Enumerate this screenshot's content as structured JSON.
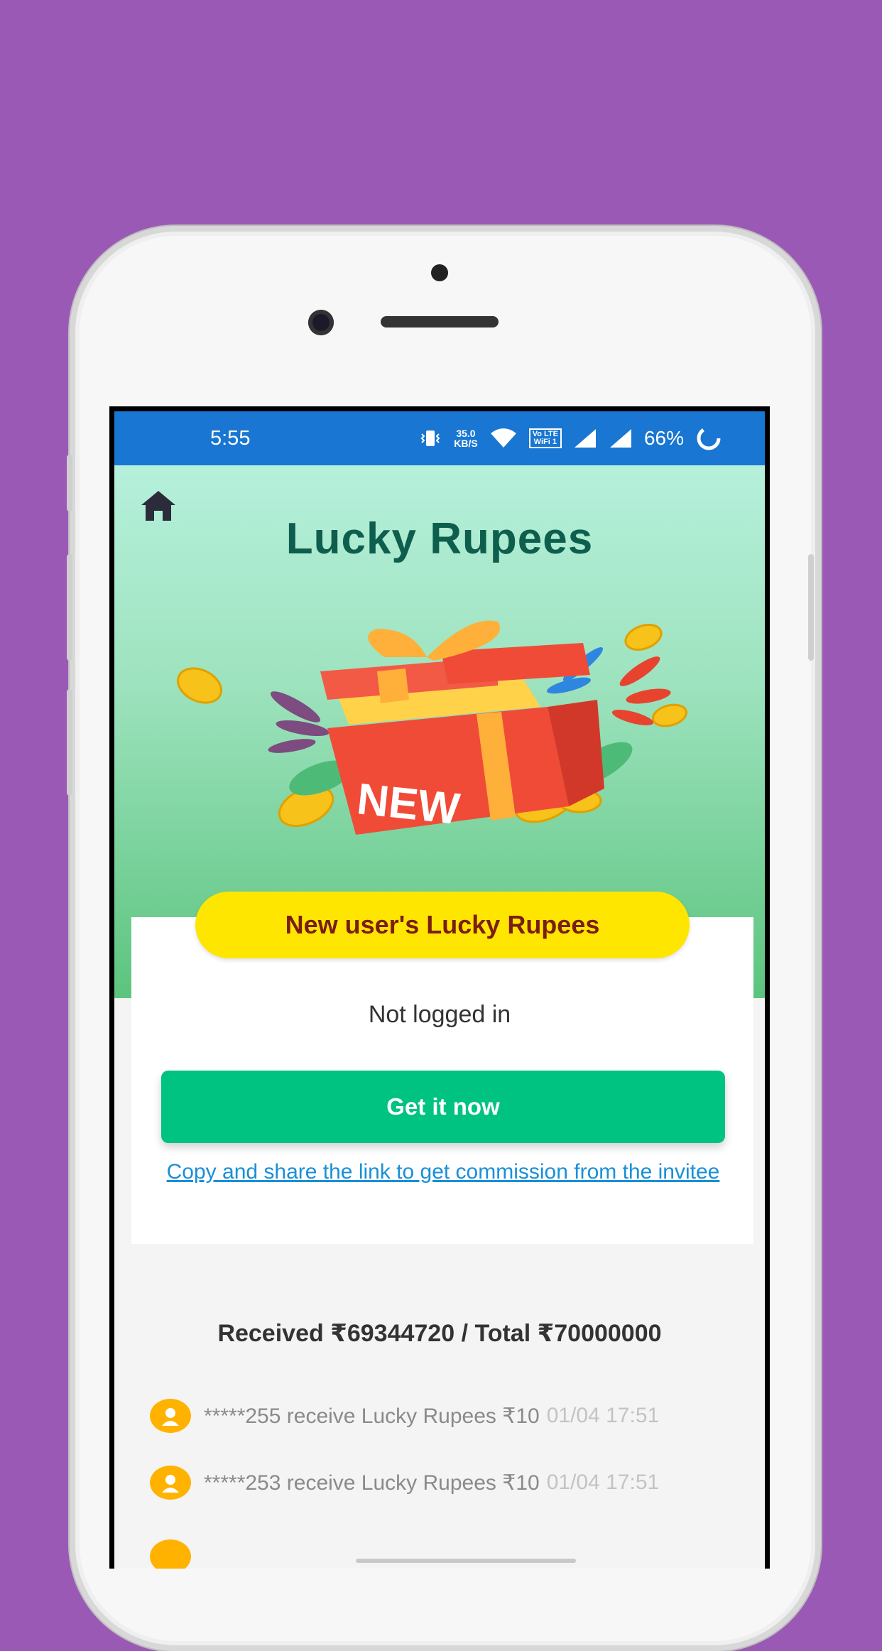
{
  "status_bar": {
    "time": "5:55",
    "speed_value": "35.0",
    "speed_unit": "KB/S",
    "volte_label": "Vo LTE",
    "wifi_label": "WiFi 1",
    "battery": "66%"
  },
  "header": {
    "title": "Lucky Rupees",
    "home_icon": "home-icon"
  },
  "illustration": {
    "box_label": "NEW"
  },
  "card": {
    "pill_label": "New user's Lucky Rupees",
    "login_status": "Not logged in",
    "cta_label": "Get it now",
    "share_link": "Copy and share the link to get commission from the invitee"
  },
  "summary": {
    "received_text": "Received ₹69344720 / Total ₹70000000"
  },
  "log": [
    {
      "text": "*****255 receive Lucky Rupees ₹10",
      "time": "01/04 17:51"
    },
    {
      "text": "*****253 receive Lucky Rupees ₹10",
      "time": "01/04 17:51"
    }
  ],
  "colors": {
    "background": "#9b59b6",
    "status_bar": "#1976d2",
    "title": "#0e5e4e",
    "pill": "#ffe600",
    "cta": "#00c281",
    "link": "#1a8fd8"
  }
}
